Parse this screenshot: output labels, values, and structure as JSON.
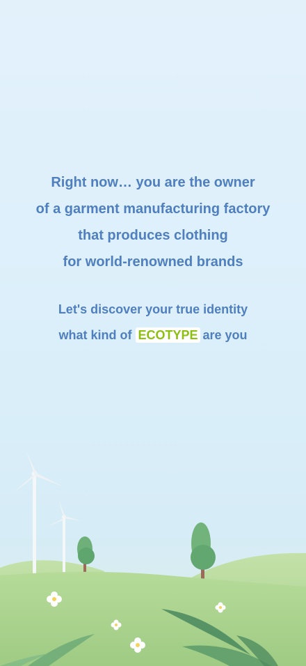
{
  "intro": {
    "lines": [
      "Right now… you are the owner",
      "of a garment manufacturing factory",
      "that produces clothing",
      "for world-renowned brands"
    ]
  },
  "cta": {
    "line1": "Let's discover your true identity",
    "line2_prefix": "what kind of",
    "highlight": "ECOTYPE",
    "line2_suffix": "are you"
  },
  "colors": {
    "text": "#4f7fbf",
    "highlight": "#8cbf12",
    "background_top": "#e3f1fb",
    "grass": "#a9d38c"
  },
  "scene": {
    "icons": [
      "wind-turbine-icon",
      "tree-icon",
      "flower-icon",
      "leaf-icon"
    ]
  }
}
